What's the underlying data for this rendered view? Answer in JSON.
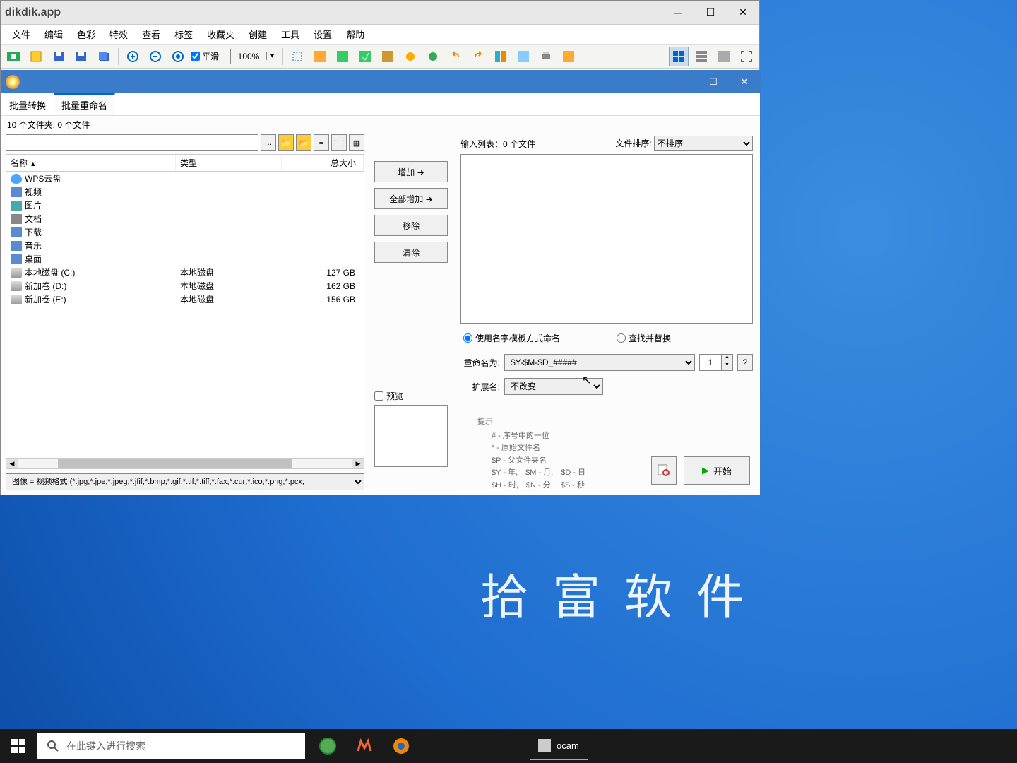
{
  "app": {
    "title": "dikdik.app"
  },
  "menu": {
    "file": "文件",
    "edit": "编辑",
    "color": "色彩",
    "effect": "特效",
    "view": "查看",
    "tag": "标签",
    "favorite": "收藏夹",
    "create": "创建",
    "tool": "工具",
    "setting": "设置",
    "help": "帮助"
  },
  "toolbar": {
    "smooth": "平滑",
    "zoom": "100%"
  },
  "inner": {
    "tabs": {
      "convert": "批量转换",
      "rename": "批量重命名"
    },
    "status": "10 个文件夹, 0 个文件"
  },
  "fileHeader": {
    "name": "名称",
    "type": "类型",
    "size": "总大小"
  },
  "files": [
    {
      "name": "WPS云盘",
      "type": "",
      "size": "",
      "ico": "cloud"
    },
    {
      "name": "视频",
      "type": "",
      "size": "",
      "ico": "folder"
    },
    {
      "name": "图片",
      "type": "",
      "size": "",
      "ico": "folder p"
    },
    {
      "name": "文档",
      "type": "",
      "size": "",
      "ico": "folder d"
    },
    {
      "name": "下载",
      "type": "",
      "size": "",
      "ico": "folder"
    },
    {
      "name": "音乐",
      "type": "",
      "size": "",
      "ico": "folder"
    },
    {
      "name": "桌面",
      "type": "",
      "size": "",
      "ico": "folder"
    },
    {
      "name": "本地磁盘 (C:)",
      "type": "本地磁盘",
      "size": "127 GB",
      "ico": "drive"
    },
    {
      "name": "新加卷 (D:)",
      "type": "本地磁盘",
      "size": "162 GB",
      "ico": "drive"
    },
    {
      "name": "新加卷 (E:)",
      "type": "本地磁盘",
      "size": "156 GB",
      "ico": "drive"
    }
  ],
  "filter": "图像 = 视频格式 (*.jpg;*.jpe;*.jpeg;*.jfif;*.bmp;*.gif;*.tif;*.tiff;*.fax;*.cur;*.ico;*.png;*.pcx;",
  "mid": {
    "add": "增加 ➜",
    "addAll": "全部增加  ➜",
    "remove": "移除",
    "clear": "清除",
    "preview": "预览"
  },
  "right": {
    "inputListLabel": "输入列表：0 个文件",
    "sortLabel": "文件排序:",
    "sortValue": "不排序",
    "radioTemplate": "使用名字模板方式命名",
    "radioReplace": "查找并替换",
    "renameLabel": "重命名为:",
    "renamePattern": "$Y-$M-$D_#####",
    "counter": "1",
    "extLabel": "扩展名:",
    "extValue": "不改变",
    "hintsTitle": "提示:",
    "hint1": "#  - 序号中的一位",
    "hint2": "*  - 原始文件名",
    "hint3": "$P - 父文件夹名",
    "hint4": "$Y - 年,　$M - 月,　$D - 日",
    "hint5": "$H - 时,　$N - 分,　$S - 秒",
    "start": "开始"
  },
  "desktop": {
    "brand": "拾富软件"
  },
  "taskbar": {
    "searchPlaceholder": "在此键入进行搜索",
    "app": "ocam"
  }
}
